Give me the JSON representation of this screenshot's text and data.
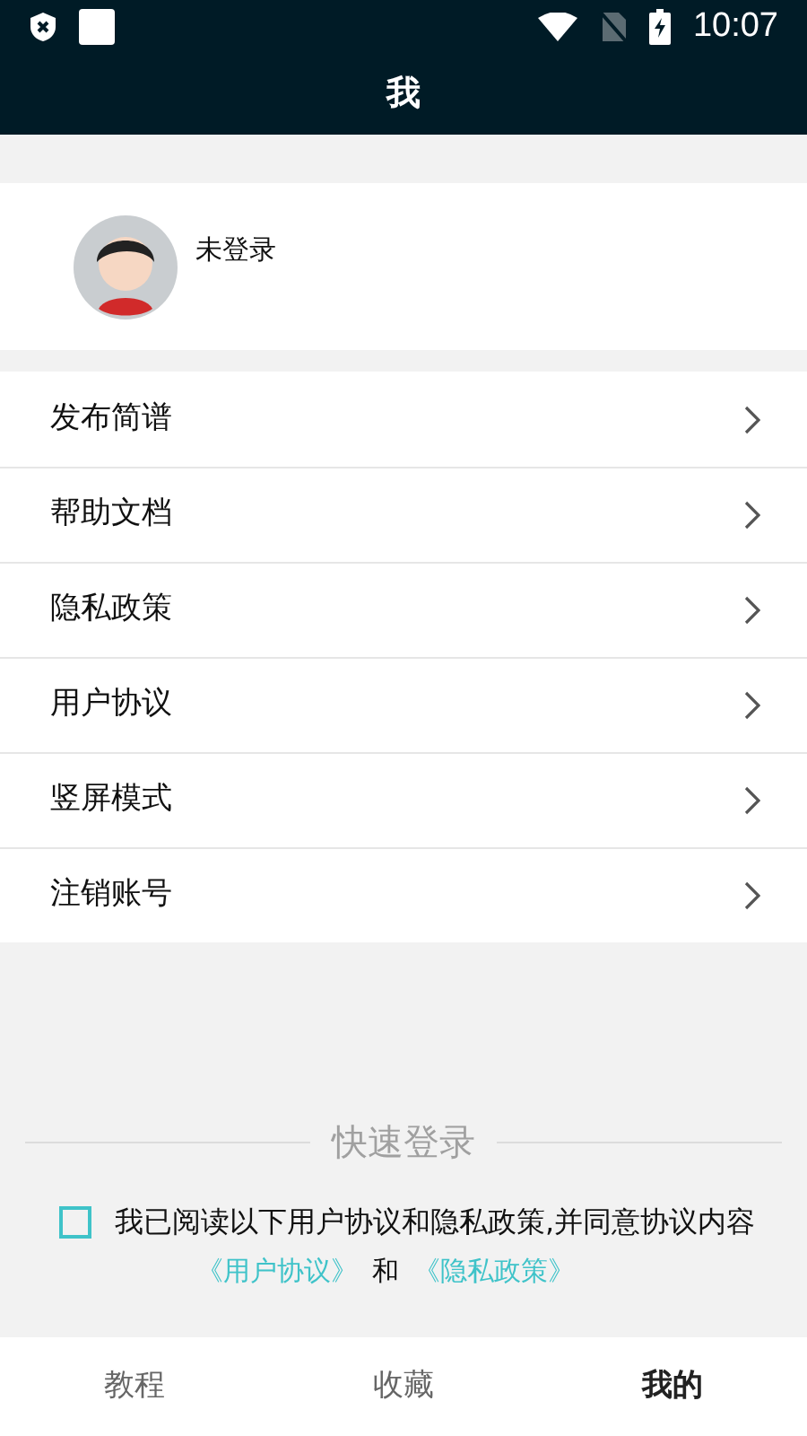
{
  "status_bar": {
    "time": "10:07"
  },
  "header": {
    "title": "我"
  },
  "profile": {
    "name": "未登录"
  },
  "menu": [
    {
      "label": "发布简谱"
    },
    {
      "label": "帮助文档"
    },
    {
      "label": "隐私政策"
    },
    {
      "label": "用户协议"
    },
    {
      "label": "竖屏模式"
    },
    {
      "label": "注销账号"
    }
  ],
  "quick_login": {
    "title": "快速登录",
    "agree_checked": false,
    "agree_text": "我已阅读以下用户协议和隐私政策,并同意协议内容",
    "links": [
      "《用户协议》",
      "和",
      "《隐私政策》"
    ]
  },
  "bottom_nav": [
    {
      "label": "教程",
      "selected": false
    },
    {
      "label": "收藏",
      "selected": false
    },
    {
      "label": "我的",
      "selected": true
    }
  ]
}
